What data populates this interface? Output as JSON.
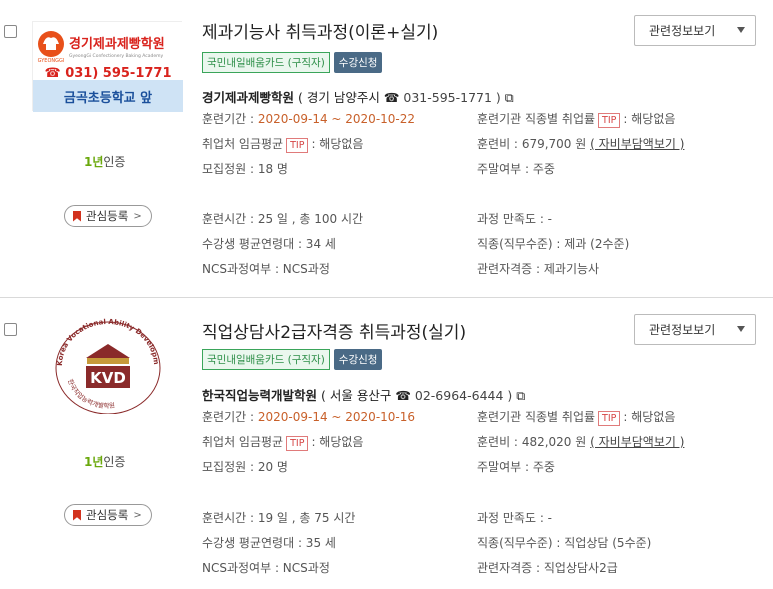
{
  "courses": [
    {
      "title": "제과기능사 취득과정(이론+실기)",
      "badge_card": "국민내일배움카드 (구직자)",
      "badge_apply": "수강신청",
      "academy": "경기제과제빵학원",
      "location": "( 경기 남양주시",
      "phone": "031-595-1771 )",
      "period_label": "훈련기간 :",
      "period": "2020-09-14 ~ 2020-10-22",
      "employ_label": "훈련기관 직종별 취업률",
      "employ_value": ": 해당없음",
      "wage_label": "취업처 임금평균",
      "wage_value": ": 해당없음",
      "fee_label": "훈련비 :",
      "fee_value": "679,700 원",
      "fee_link": "( 자비부담액보기 )",
      "quota": "모집정원 : 18 명",
      "weekend": "주말여부 : 주중",
      "hours": "훈련시간 : 25 일 , 총 100 시간",
      "satisfaction": "과정 만족도 : -",
      "age": "수강생 평균연령대 : 34 세",
      "job": "직종(직무수준) : 제과 (2수준)",
      "ncs": "NCS과정여부 : NCS과정",
      "license": "관련자격증 : 제과기능사",
      "logo": {
        "name": "경기제과제빵학원",
        "sub": "GyeongGi Confectionery Baking Academy",
        "tag": "GYEONGGI",
        "phone": "☎ 031) 595-1771",
        "addr": "금곡초등학교 앞"
      }
    },
    {
      "title": "직업상담사2급자격증 취득과정(실기)",
      "badge_card": "국민내일배움카드 (구직자)",
      "badge_apply": "수강신청",
      "academy": "한국직업능력개발학원",
      "location": "( 서울 용산구",
      "phone": "02-6964-6444 )",
      "period_label": "훈련기간 :",
      "period": "2020-09-14 ~ 2020-10-16",
      "employ_label": "훈련기관 직종별 취업률",
      "employ_value": ": 해당없음",
      "wage_label": "취업처 임금평균",
      "wage_value": ": 해당없음",
      "fee_label": "훈련비 :",
      "fee_value": "482,020 원",
      "fee_link": "( 자비부담액보기 )",
      "quota": "모집정원 : 20 명",
      "weekend": "주말여부 : 주중",
      "hours": "훈련시간 : 19 일 , 총 75 시간",
      "satisfaction": "과정 만족도 : -",
      "age": "수강생 평균연령대 : 35 세",
      "job": "직종(직무수준) : 직업상담 (5수준)",
      "ncs": "NCS과정여부 : NCS과정",
      "license": "관련자격증 : 직업상담사2급",
      "logo": {
        "ring_top": "Korea Vocational Ability Development Institute",
        "ring_bottom": "한국직업능력개발학원",
        "letters": "KVD"
      }
    }
  ],
  "common": {
    "tip": "TIP",
    "cert_year": "1년",
    "cert_text": "인증",
    "fav_label": "관심등록",
    "related_select": "관련정보보기"
  },
  "colors": {
    "date": "#c8602a",
    "green": "#3aa55a",
    "apply": "#4a6a86"
  }
}
